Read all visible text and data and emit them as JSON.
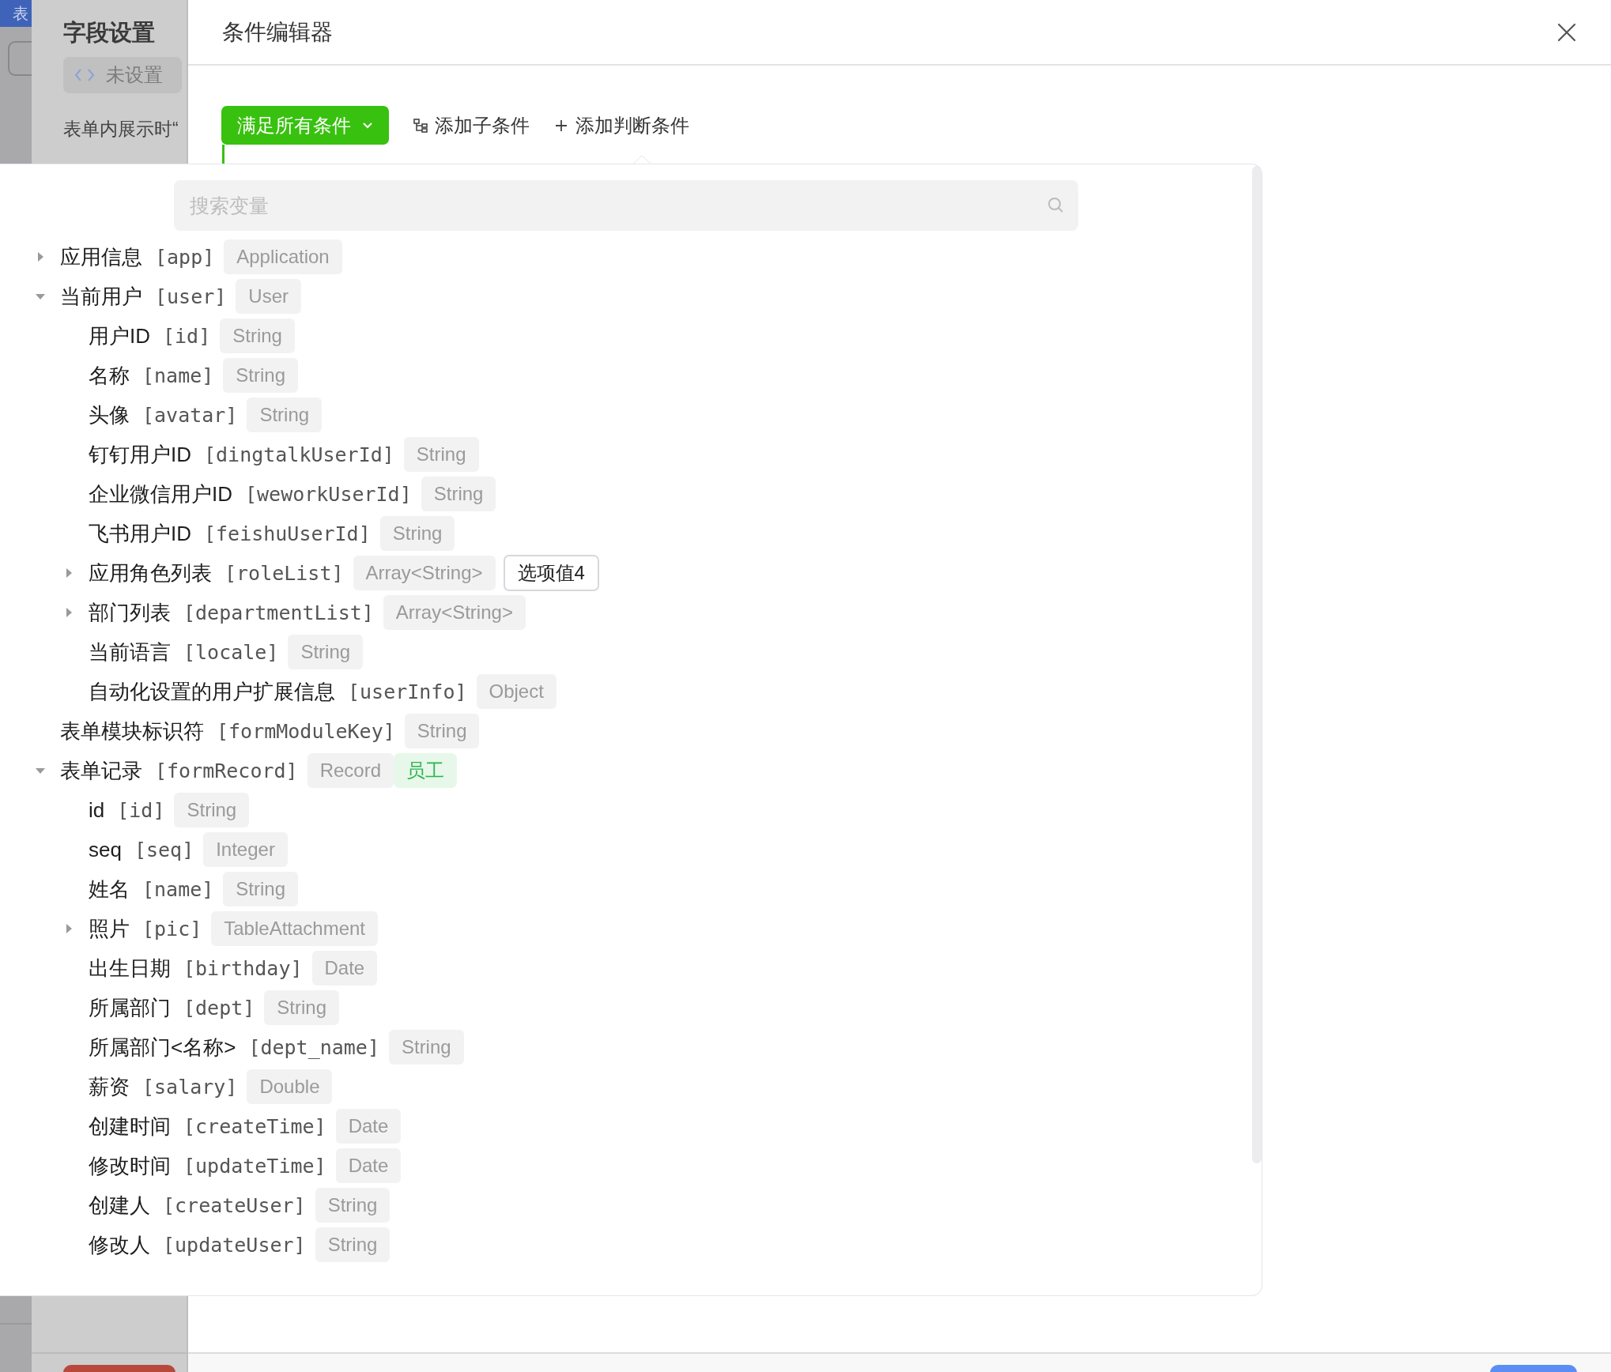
{
  "background": {
    "tag": "表",
    "panel_title": "字段设置",
    "chip": "未设置",
    "hint": "表单内展示时“"
  },
  "drawer": {
    "title": "条件编辑器"
  },
  "toolbar": {
    "match_button": "满足所有条件",
    "add_child": "添加子条件",
    "add_condition": "添加判断条件"
  },
  "variable_picker": {
    "search": {
      "placeholder": "搜索变量"
    },
    "items": [
      {
        "label": "应用信息",
        "key": "[app]",
        "type": "Application",
        "expanded": false
      },
      {
        "label": "当前用户",
        "key": "[user]",
        "type": "User",
        "expanded": true,
        "children": [
          {
            "label": "用户ID",
            "key": "[id]",
            "type": "String"
          },
          {
            "label": "名称",
            "key": "[name]",
            "type": "String"
          },
          {
            "label": "头像",
            "key": "[avatar]",
            "type": "String"
          },
          {
            "label": "钉钉用户ID",
            "key": "[dingtalkUserId]",
            "type": "String"
          },
          {
            "label": "企业微信用户ID",
            "key": "[weworkUserId]",
            "type": "String"
          },
          {
            "label": "飞书用户ID",
            "key": "[feishuUserId]",
            "type": "String"
          },
          {
            "label": "应用角色列表",
            "key": "[roleList]",
            "type": "Array<String>",
            "expanded": false,
            "badge": {
              "text": "选项值4",
              "kind": "option"
            }
          },
          {
            "label": "部门列表",
            "key": "[departmentList]",
            "type": "Array<String>",
            "expanded": false
          },
          {
            "label": "当前语言",
            "key": "[locale]",
            "type": "String"
          },
          {
            "label": "自动化设置的用户扩展信息",
            "key": "[userInfo]",
            "type": "Object"
          }
        ]
      },
      {
        "label": "表单模块标识符",
        "key": "[formModuleKey]",
        "type": "String"
      },
      {
        "label": "表单记录",
        "key": "[formRecord]",
        "type": "Record",
        "expanded": true,
        "badge": {
          "text": "员工",
          "kind": "relation"
        },
        "children": [
          {
            "label": "id",
            "key": "[id]",
            "type": "String"
          },
          {
            "label": "seq",
            "key": "[seq]",
            "type": "Integer"
          },
          {
            "label": "姓名",
            "key": "[name]",
            "type": "String"
          },
          {
            "label": "照片",
            "key": "[pic]",
            "type": "TableAttachment",
            "expanded": false
          },
          {
            "label": "出生日期",
            "key": "[birthday]",
            "type": "Date"
          },
          {
            "label": "所属部门",
            "key": "[dept]",
            "type": "String"
          },
          {
            "label": "所属部门<名称>",
            "key": "[dept_name]",
            "type": "String"
          },
          {
            "label": "薪资",
            "key": "[salary]",
            "type": "Double"
          },
          {
            "label": "创建时间",
            "key": "[createTime]",
            "type": "Date"
          },
          {
            "label": "修改时间",
            "key": "[updateTime]",
            "type": "Date"
          },
          {
            "label": "创建人",
            "key": "[createUser]",
            "type": "String"
          },
          {
            "label": "修改人",
            "key": "[updateUser]",
            "type": "String"
          }
        ]
      }
    ]
  }
}
